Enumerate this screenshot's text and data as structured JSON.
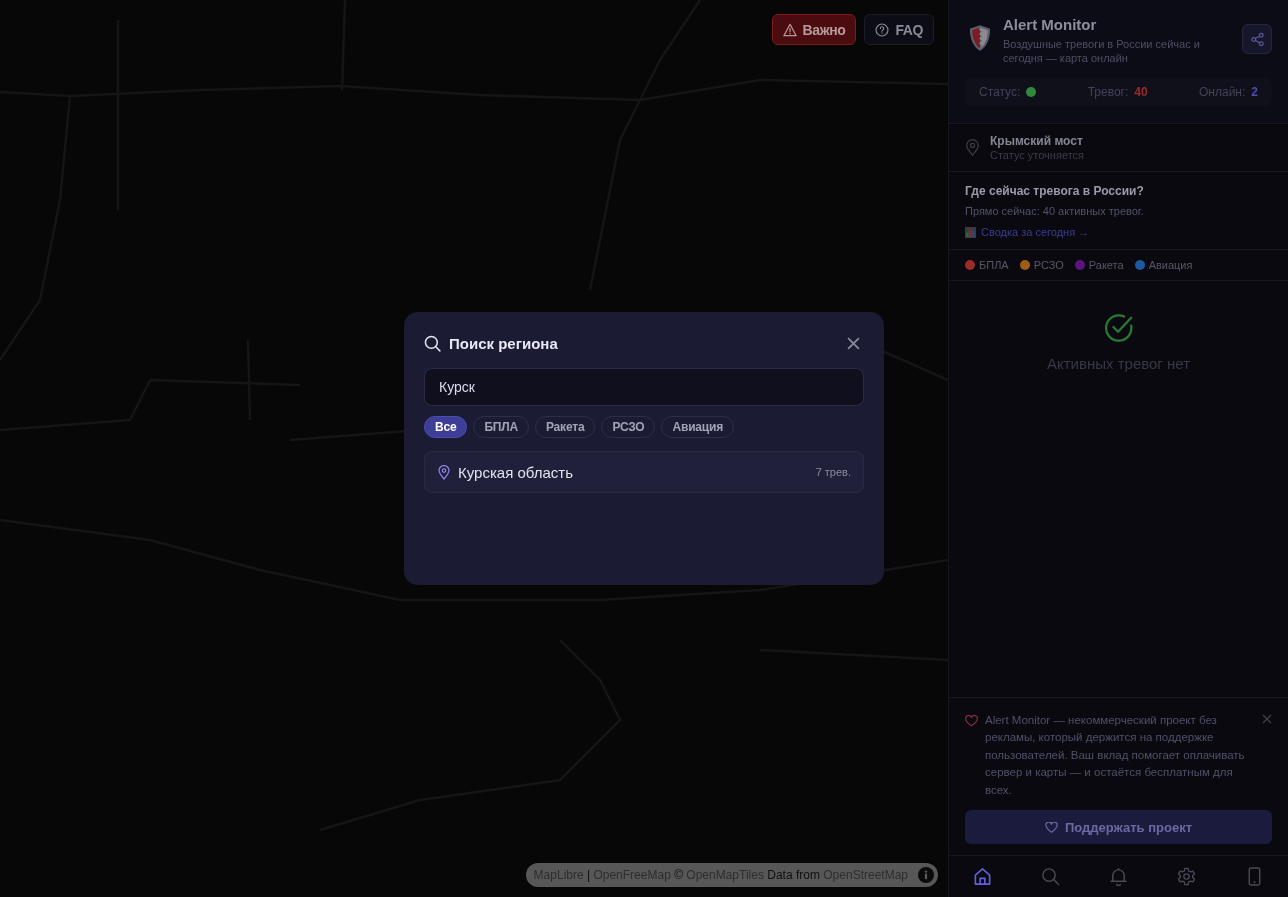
{
  "map": {
    "attribution": [
      {
        "kind": "link",
        "text": "MapLibre"
      },
      {
        "kind": "text",
        "text": " | "
      },
      {
        "kind": "link",
        "text": "OpenFreeMap"
      },
      {
        "kind": "text",
        "text": " © "
      },
      {
        "kind": "link",
        "text": "OpenMapTiles"
      },
      {
        "kind": "text",
        "text": " Data from "
      },
      {
        "kind": "link",
        "text": "OpenStreetMap"
      }
    ]
  },
  "top_buttons": [
    {
      "kind": "warning",
      "label": "Важно"
    },
    {
      "kind": "help",
      "label": "FAQ"
    }
  ],
  "search_dialog": {
    "title": "Поиск региона",
    "query": "Курск",
    "filters": [
      {
        "label": "Все",
        "selected": true
      },
      {
        "label": "БПЛА",
        "selected": false
      },
      {
        "label": "Ракета",
        "selected": false
      },
      {
        "label": "РСЗО",
        "selected": false
      },
      {
        "label": "Авиация",
        "selected": false
      }
    ],
    "results": [
      {
        "name": "Курская область",
        "count": "7 трев."
      }
    ]
  },
  "sidebar": {
    "title": "Alert Monitor",
    "subtitle": "Воздушные тревоги в России сейчас и сегодня — карта онлайн",
    "stats": [
      {
        "kind": "status",
        "label": "Статус:",
        "online": true
      },
      {
        "kind": "alerts",
        "label": "Тревог:",
        "value": "40"
      },
      {
        "kind": "users",
        "label": "Онлайн:",
        "value": "2"
      }
    ],
    "location": {
      "name": "Крымский мост",
      "status": "Статус уточняется"
    },
    "info": {
      "heading": "Где сейчас тревога в России?",
      "text": "Прямо сейчас: 40 активных тревог.",
      "link": "Сводка за сегодня →"
    },
    "legend": [
      {
        "label": "БПЛА",
        "color": "#9e2b2b"
      },
      {
        "label": "РСЗО",
        "color": "#a05c12"
      },
      {
        "label": "Ракета",
        "color": "#5c1480"
      },
      {
        "label": "Авиация",
        "color": "#1c5a9e"
      }
    ],
    "empty_state": "Активных тревог нет",
    "support": {
      "text": "Alert Monitor — некоммерческий проект без рекламы, который держится на поддержке пользователей. Ваш вклад помогает оплачивать сервер и карты — и остаётся бесплатным для всех.",
      "button": "Поддержать проект"
    },
    "nav": [
      {
        "kind": "home",
        "selected": true
      },
      {
        "kind": "search",
        "selected": false
      },
      {
        "kind": "alerts",
        "selected": false
      },
      {
        "kind": "settings",
        "selected": false
      },
      {
        "kind": "device",
        "selected": false
      }
    ]
  }
}
